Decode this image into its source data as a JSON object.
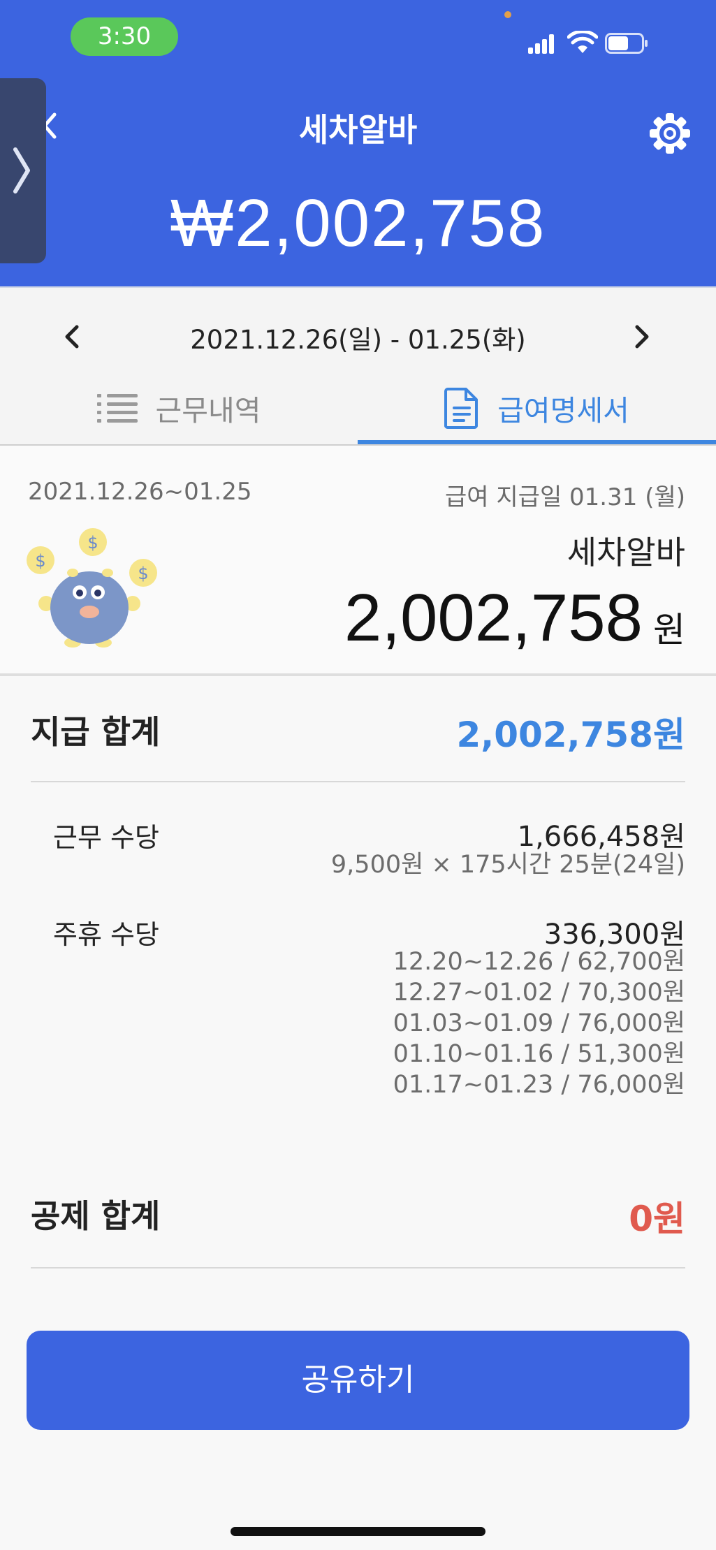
{
  "status_bar": {
    "time": "3:30"
  },
  "header": {
    "title": "세차알바",
    "total_amount": "₩2,002,758"
  },
  "period": {
    "range": "2021.12.26(일) - 01.25(화)"
  },
  "tabs": [
    {
      "label": "근무내역",
      "active": false
    },
    {
      "label": "급여명세서",
      "active": true
    }
  ],
  "summary": {
    "range": "2021.12.26~01.25",
    "pay_date": "급여 지급일 01.31 (월)",
    "job_name": "세차알바",
    "amount": "2,002,758",
    "unit": "원"
  },
  "payments": {
    "label": "지급 합계",
    "total": "2,002,758원",
    "items": [
      {
        "label": "근무 수당",
        "value": "1,666,458원",
        "details": [
          "9,500원 × 175시간 25분(24일)"
        ]
      },
      {
        "label": "주휴 수당",
        "value": "336,300원",
        "details": [
          "12.20~12.26 / 62,700원",
          "12.27~01.02 / 70,300원",
          "01.03~01.09 / 76,000원",
          "01.10~01.16 / 51,300원",
          "01.17~01.23 / 76,000원"
        ]
      }
    ]
  },
  "deductions": {
    "label": "공제 합계",
    "total": "0원"
  },
  "share_button": "공유하기",
  "colors": {
    "brand": "#3c64e0",
    "accent": "#3d86e0",
    "negative": "#e05a4e"
  }
}
